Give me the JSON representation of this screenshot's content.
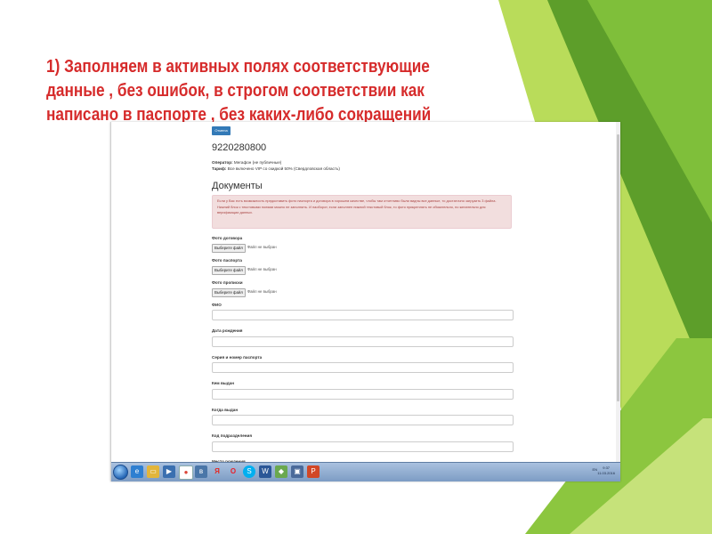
{
  "slide": {
    "title": "1) Заполняем в активных полях соответствующие данные , без ошибок, в строгом соответствии как написано в паспорте , без каких-либо сокращений",
    "colors": {
      "title": "#d62b2b",
      "accent_green": "#5fa31f",
      "light_green": "#a6d64a"
    }
  },
  "form": {
    "cancel_label": "Отмена",
    "phone": "9220280800",
    "operator_label": "Оператор:",
    "operator_value": "Мегафон (не публичные)",
    "tariff_label": "Тариф:",
    "tariff_value": "Все включено VIP со скидкой 50% (Свердловская область)",
    "section_title": "Документы",
    "alert_text": "Если у Вас есть возможность предоставить фото паспорта и договора в хорошем качестве, чтобы там отчетливо были видны все данные, то достаточно загрузить 3 файла. Нижний блок с текстовыми полями можно не заполнить. И наоборот, если заполнен нижний текстовый блок, то фото прикреплять не обязательно, но желательно для верификации данных.",
    "file_button_label": "Выберите файл",
    "file_status": "Файл не выбран",
    "file_fields": [
      {
        "label": "Фото договора"
      },
      {
        "label": "Фото паспорта"
      },
      {
        "label": "Фото прописки"
      }
    ],
    "text_fields": [
      {
        "label": "ФИО"
      },
      {
        "label": "Дата рождения"
      },
      {
        "label": "Серия и номер паспорта"
      },
      {
        "label": "Кем выдан"
      },
      {
        "label": "Когда выдан"
      },
      {
        "label": "Код подразделения"
      },
      {
        "label": "Место рождения"
      }
    ]
  },
  "taskbar": {
    "language": "EN",
    "time": "9:37",
    "date": "11.03.2016",
    "icons": [
      "ie-icon",
      "explorer-icon",
      "media-icon",
      "chrome-icon",
      "vk-icon",
      "yandex-icon",
      "opera-icon",
      "skype-icon",
      "word-icon",
      "security-icon",
      "network-icon",
      "powerpoint-icon"
    ]
  }
}
